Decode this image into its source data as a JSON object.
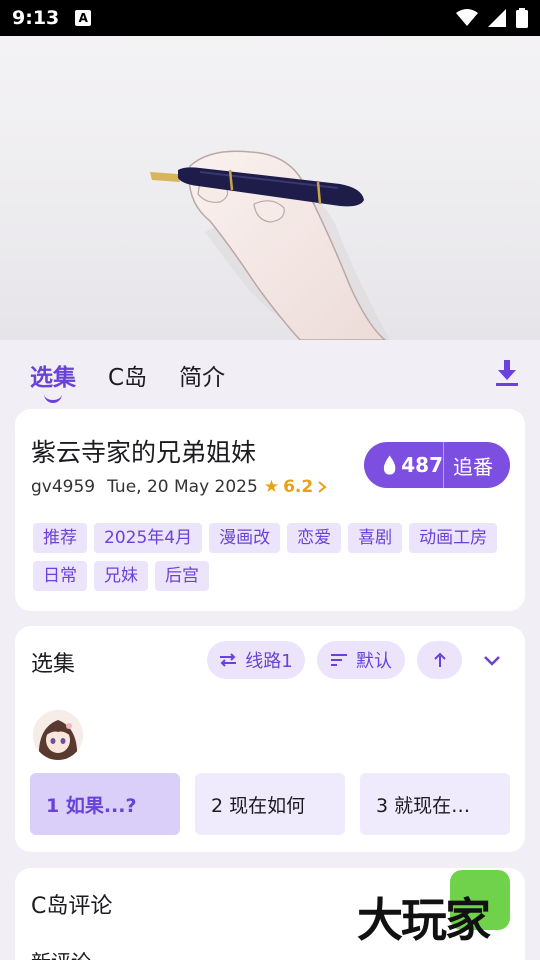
{
  "statusbar": {
    "time": "9:13",
    "a_icon": "A"
  },
  "tabs": [
    {
      "label": "选集",
      "active": true
    },
    {
      "label": "C岛",
      "active": false
    },
    {
      "label": "简介",
      "active": false
    }
  ],
  "info": {
    "title": "紫云寺家的兄弟姐妹",
    "id": "gv4959",
    "date": "Tue, 20 May 2025",
    "rating": "6.2",
    "follow_count": "487",
    "follow_label": "追番",
    "tags": [
      "推荐",
      "2025年4月",
      "漫画改",
      "恋爱",
      "喜剧",
      "动画工房",
      "日常",
      "兄妹",
      "后宫"
    ]
  },
  "episodes": {
    "title": "选集",
    "route_label": "线路1",
    "sort_label": "默认",
    "list": [
      {
        "label": "1 如果...?",
        "active": true
      },
      {
        "label": "2 现在如何",
        "active": false
      },
      {
        "label": "3 就现在…",
        "active": false
      }
    ]
  },
  "comments": {
    "title": "C岛评论",
    "sub": "新评论"
  },
  "watermark": "大玩家",
  "colors": {
    "accent": "#7c4fe0",
    "tag_bg": "#ece4fb",
    "highlight": "#b5ec8a",
    "rating": "#e8a215"
  }
}
